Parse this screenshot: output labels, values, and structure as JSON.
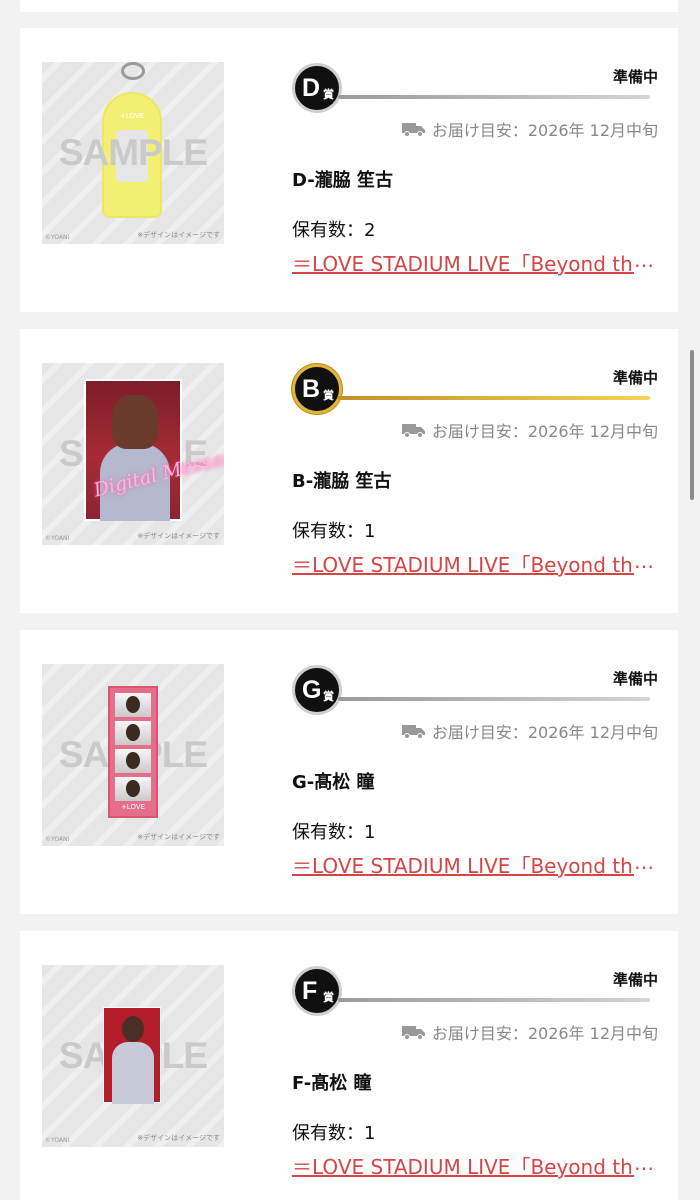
{
  "items": [
    {
      "rank_letter": "D",
      "rank_suffix": "賞",
      "status": "準備中",
      "delivery": "お届け目安：2026年 12月中旬",
      "name": "D-瀧脇 笙古",
      "owned_label": "保有数：",
      "owned_count": "2",
      "event_link": "＝LOVE STADIUM LIVE「Beyond the Stage」",
      "ellipsis": "…",
      "image": {
        "sample": "SAMPLE",
        "note": "※デザインはイメージです",
        "copyright": "©YOANI",
        "product": "+LOVE"
      }
    },
    {
      "rank_letter": "B",
      "rank_suffix": "賞",
      "status": "準備中",
      "delivery": "お届け目安：2026年 12月中旬",
      "name": "B-瀧脇 笙古",
      "owned_label": "保有数：",
      "owned_count": "1",
      "event_link": "＝LOVE STADIUM LIVE「Beyond the Stage」",
      "ellipsis": "…",
      "image": {
        "sample": "SAMPLE",
        "note": "※デザインはイメージです",
        "copyright": "©YOANI",
        "product": "Digital Message"
      }
    },
    {
      "rank_letter": "G",
      "rank_suffix": "賞",
      "status": "準備中",
      "delivery": "お届け目安：2026年 12月中旬",
      "name": "G-髙松 瞳",
      "owned_label": "保有数：",
      "owned_count": "1",
      "event_link": "＝LOVE STADIUM LIVE「Beyond the Stage」",
      "ellipsis": "…",
      "image": {
        "sample": "SAMPLE",
        "note": "※デザインはイメージです",
        "copyright": "©YOANI",
        "product": "+LOVE"
      }
    },
    {
      "rank_letter": "F",
      "rank_suffix": "賞",
      "status": "準備中",
      "delivery": "お届け目安：2026年 12月中旬",
      "name": "F-髙松 瞳",
      "owned_label": "保有数：",
      "owned_count": "1",
      "event_link": "＝LOVE STADIUM LIVE「Beyond the Stage」",
      "ellipsis": "…",
      "image": {
        "sample": "SAMPLE",
        "note": "※デザインはイメージです",
        "copyright": "©YOANI"
      }
    }
  ],
  "icons": {
    "truck": "delivery-truck-icon"
  },
  "colors": {
    "link": "#d64545",
    "gold_badge": "#e2b43a",
    "silver_badge": "#cfcfcf",
    "status_text": "#111111"
  }
}
